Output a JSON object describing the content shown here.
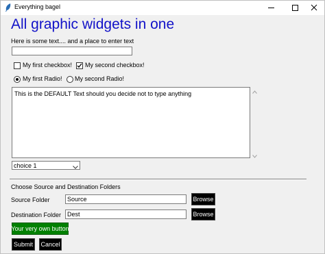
{
  "window": {
    "title": "Everything bagel"
  },
  "heading": "All graphic widgets in one",
  "prompt_label": "Here is some text.... and a place to enter text",
  "text_input": {
    "value": ""
  },
  "checkboxes": [
    {
      "label": "My first checkbox!",
      "checked": false
    },
    {
      "label": "My second checkbox!",
      "checked": true
    }
  ],
  "radios": [
    {
      "label": "My first Radio!",
      "selected": true
    },
    {
      "label": "My second Radio!",
      "selected": false
    }
  ],
  "multiline": {
    "value": "This is the DEFAULT Text should you decide not to type anything"
  },
  "combo": {
    "selected": "choice 1"
  },
  "folders": {
    "section_label": "Choose Source and Destination Folders",
    "source_label": "Source Folder",
    "source_value": "Source",
    "dest_label": "Destination Folder",
    "dest_value": "Dest",
    "browse_label": "Browse"
  },
  "custom_button": "Your very own button",
  "submit_label": "Submit",
  "cancel_label": "Cancel",
  "colors": {
    "heading": "#1212c8",
    "custom_button_bg": "#018001",
    "dark_button_bg": "#000000"
  }
}
